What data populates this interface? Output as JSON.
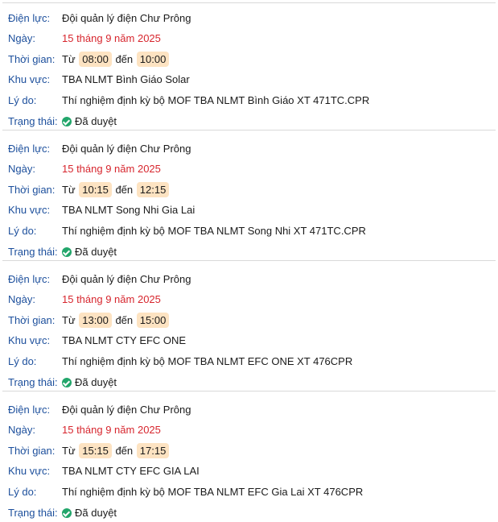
{
  "labels": {
    "unit": "Điện lực:",
    "date": "Ngày:",
    "time": "Thời gian:",
    "area": "Khu vực:",
    "reason": "Lý do:",
    "status": "Trạng thái:",
    "from": "Từ",
    "to": "đến"
  },
  "colors": {
    "label": "#1c4f9c",
    "date": "#d7262e",
    "time_pill_bg": "#fde3c2",
    "status_check": "#22a66b",
    "divider": "#d9d9d9"
  },
  "entries": [
    {
      "unit": "Đội quản lý điện Chư Prông",
      "date": "15 tháng 9 năm 2025",
      "start": "08:00",
      "end": "10:00",
      "area": "TBA NLMT Bình Giáo Solar",
      "reason": "Thí nghiệm định kỳ bộ MOF TBA NLMT Bình Giáo XT 471TC.CPR",
      "status": "Đã duyệt"
    },
    {
      "unit": "Đội quản lý điện Chư Prông",
      "date": "15 tháng 9 năm 2025",
      "start": "10:15",
      "end": "12:15",
      "area": "TBA NLMT Song Nhi Gia Lai",
      "reason": "Thí nghiệm định kỳ bộ MOF TBA NLMT Song Nhi XT 471TC.CPR",
      "status": "Đã duyệt"
    },
    {
      "unit": "Đội quản lý điện Chư Prông",
      "date": "15 tháng 9 năm 2025",
      "start": "13:00",
      "end": "15:00",
      "area": "TBA NLMT CTY EFC ONE",
      "reason": "Thí nghiệm định kỳ bộ MOF TBA NLMT EFC ONE XT 476CPR",
      "status": "Đã duyệt"
    },
    {
      "unit": "Đội quản lý điện Chư Prông",
      "date": "15 tháng 9 năm 2025",
      "start": "15:15",
      "end": "17:15",
      "area": "TBA NLMT CTY EFC GIA LAI",
      "reason": "Thí nghiệm định kỳ bộ MOF TBA NLMT EFC Gia Lai XT 476CPR",
      "status": "Đã duyệt"
    }
  ]
}
